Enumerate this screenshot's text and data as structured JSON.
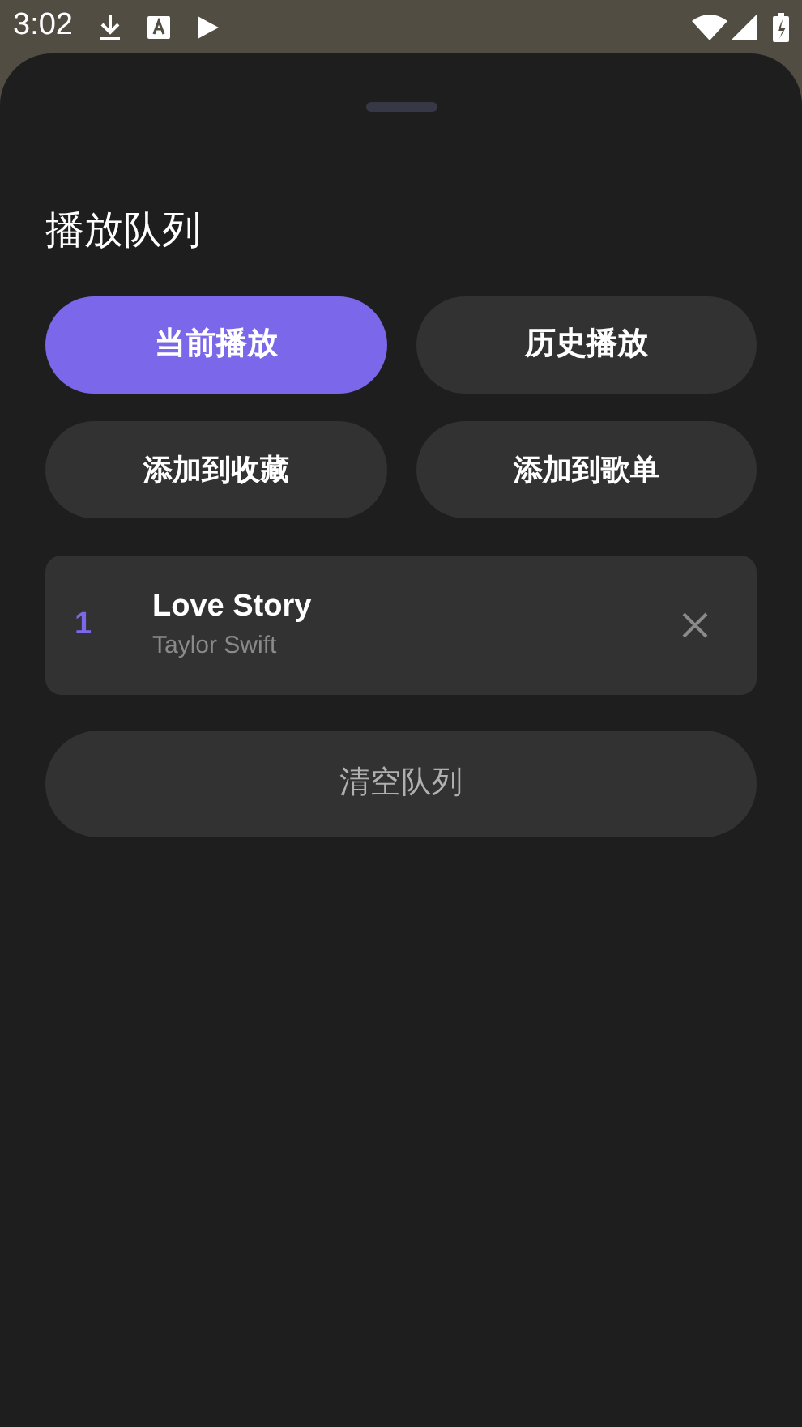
{
  "status_bar": {
    "time": "3:02"
  },
  "title": "播放队列",
  "tabs": [
    {
      "label": "当前播放",
      "selected": true
    },
    {
      "label": "历史播放",
      "selected": false
    }
  ],
  "actions": [
    "添加到收藏",
    "添加到歌单"
  ],
  "queue": [
    {
      "index": "1",
      "title": "Love Story",
      "artist": "Taylor Swift"
    }
  ],
  "clear_button": "清空队列"
}
